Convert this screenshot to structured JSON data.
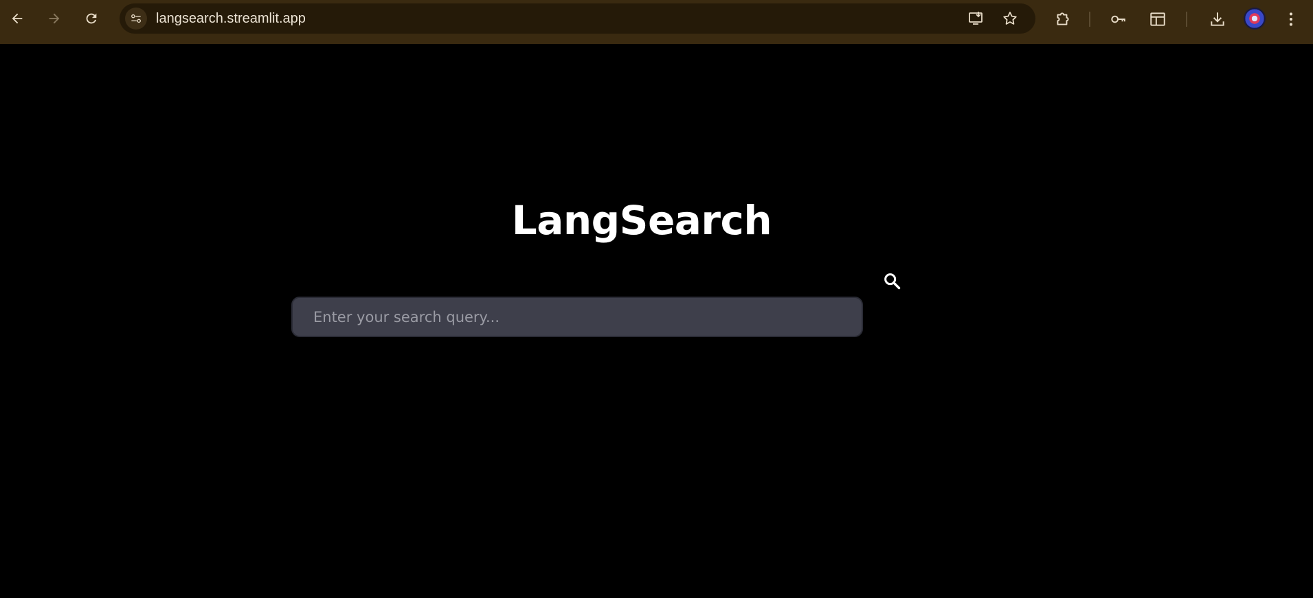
{
  "browser": {
    "url": "langsearch.streamlit.app",
    "icons": {
      "back": "arrow-left-icon",
      "forward": "arrow-right-icon",
      "reload": "reload-icon",
      "site_info": "site-settings-icon",
      "install": "install-app-icon",
      "bookmark": "star-icon",
      "extensions": "puzzle-icon",
      "passwords": "key-icon",
      "side_panel": "side-panel-icon",
      "downloads": "download-icon",
      "menu": "kebab-menu-icon"
    },
    "colors": {
      "frame": "#3a2a10",
      "omnibox": "#251a08",
      "icon": "#e8dcc8"
    }
  },
  "app": {
    "title": "LangSearch",
    "search": {
      "placeholder": "Enter your search query...",
      "value": "",
      "icon": "search-icon"
    },
    "colors": {
      "background": "#000000",
      "input_bg": "#3e3f4b",
      "text": "#ffffff"
    }
  }
}
